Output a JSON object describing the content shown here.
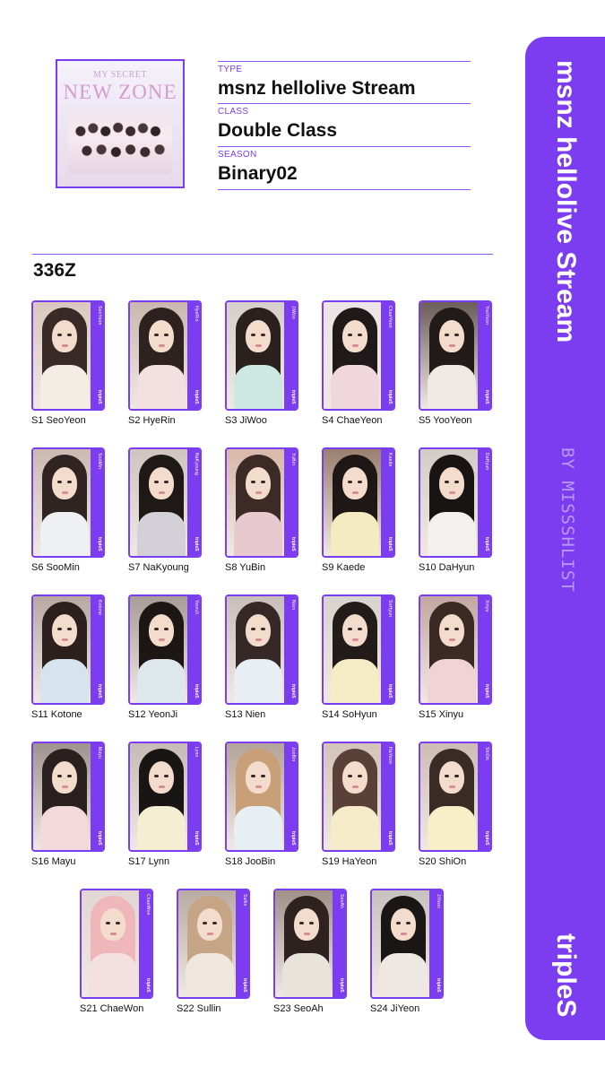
{
  "album": {
    "cover_title_small": "MY SECRET",
    "cover_title_big": "NEW ZONE"
  },
  "meta": {
    "type_label": "TYPE",
    "type_value": "msnz hellolive Stream",
    "class_label": "CLASS",
    "class_value": "Double Class",
    "season_label": "SEASON",
    "season_value": "Binary02"
  },
  "collection_title": "336Z",
  "card_strip_brand": "tripleS",
  "cards": [
    {
      "caption": "S1 SeoYeon",
      "name": "SeoYeon",
      "hair": "#3a2a27",
      "outfit": "#f3ede6",
      "bg": "#d9c8bd"
    },
    {
      "caption": "S2 HyeRin",
      "name": "HyeRin",
      "hair": "#2d2220",
      "outfit": "#f2dfe0",
      "bg": "#c9b7ad"
    },
    {
      "caption": "S3 JiWoo",
      "name": "JiWoo",
      "hair": "#2a211f",
      "outfit": "#cde8e2",
      "bg": "#d6cfc9"
    },
    {
      "caption": "S4 ChaeYeon",
      "name": "ChaeYeon",
      "hair": "#1f1a19",
      "outfit": "#f2d6dd",
      "bg": "#ece4e6"
    },
    {
      "caption": "S5 YooYeon",
      "name": "YooYeon",
      "hair": "#231b1a",
      "outfit": "#efe9e4",
      "bg": "#6b5d57"
    },
    {
      "caption": "S6 SooMin",
      "name": "SooMin",
      "hair": "#2f2422",
      "outfit": "#eef0f4",
      "bg": "#cbb9b1"
    },
    {
      "caption": "S7 NaKyoung",
      "name": "NaKyoung",
      "hair": "#1e1817",
      "outfit": "#d3d0d8",
      "bg": "#cfc4be"
    },
    {
      "caption": "S8 YuBin",
      "name": "YuBin",
      "hair": "#3b2a25",
      "outfit": "#e8c9cf",
      "bg": "#d8b8a8"
    },
    {
      "caption": "S9 Kaede",
      "name": "Kaede",
      "hair": "#1e1716",
      "outfit": "#f4ecc0",
      "bg": "#9a7f70"
    },
    {
      "caption": "S10 DaHyun",
      "name": "DaHyun",
      "hair": "#191414",
      "outfit": "#f3f1ee",
      "bg": "#d2cbc6"
    },
    {
      "caption": "S11 Kotone",
      "name": "Kotone",
      "hair": "#2b201e",
      "outfit": "#d6e4ef",
      "bg": "#b7a9a2"
    },
    {
      "caption": "S12 YeonJi",
      "name": "YeonJi",
      "hair": "#1c1615",
      "outfit": "#dde7ec",
      "bg": "#a89c97"
    },
    {
      "caption": "S13 Nien",
      "name": "Nien",
      "hair": "#362826",
      "outfit": "#e8eef4",
      "bg": "#c8bfb9"
    },
    {
      "caption": "S14 SoHyun",
      "name": "SoHyun",
      "hair": "#231b1a",
      "outfit": "#f4ecc4",
      "bg": "#d9d3cd"
    },
    {
      "caption": "S15 Xinyu",
      "name": "Xinyu",
      "hair": "#3a2925",
      "outfit": "#f1d3d5",
      "bg": "#c2a7a0"
    },
    {
      "caption": "S16 Mayu",
      "name": "Mayu",
      "hair": "#2a201f",
      "outfit": "#f3d8dc",
      "bg": "#9f938e"
    },
    {
      "caption": "S17 Lynn",
      "name": "Lynn",
      "hair": "#1a1515",
      "outfit": "#f4eed3",
      "bg": "#c7bcb5"
    },
    {
      "caption": "S18 JooBin",
      "name": "JooBin",
      "hair": "#c99f78",
      "outfit": "#e7eff3",
      "bg": "#b4a49a"
    },
    {
      "caption": "S19 HaYeon",
      "name": "HaYeon",
      "hair": "#5a4036",
      "outfit": "#f5ebc9",
      "bg": "#d3c3b8"
    },
    {
      "caption": "S20 ShiOn",
      "name": "ShiOn",
      "hair": "#3a2b27",
      "outfit": "#f6efc8",
      "bg": "#cdbcb4"
    },
    {
      "caption": "S21 ChaeWon",
      "name": "ChaeWon",
      "hair": "#f0b7bb",
      "outfit": "#f5e0e0",
      "bg": "#e1d6d3"
    },
    {
      "caption": "S22 Sullin",
      "name": "Sullin",
      "hair": "#c6a486",
      "outfit": "#efe7de",
      "bg": "#b8aba3"
    },
    {
      "caption": "S23 SeoAh",
      "name": "SeoAh",
      "hair": "#2e2220",
      "outfit": "#e9e3dc",
      "bg": "#a09088"
    },
    {
      "caption": "S24 JiYeon",
      "name": "JiYeon",
      "hair": "#1b1616",
      "outfit": "#efe7e1",
      "bg": "#c7c1bf"
    }
  ],
  "side_panel": {
    "title": "msnz hellolive Stream",
    "credit": "BY MISSSHLIST",
    "group": "tripleS"
  },
  "colors": {
    "accent": "#7c3cf0",
    "text": "#111111",
    "background": "#ffffff"
  }
}
